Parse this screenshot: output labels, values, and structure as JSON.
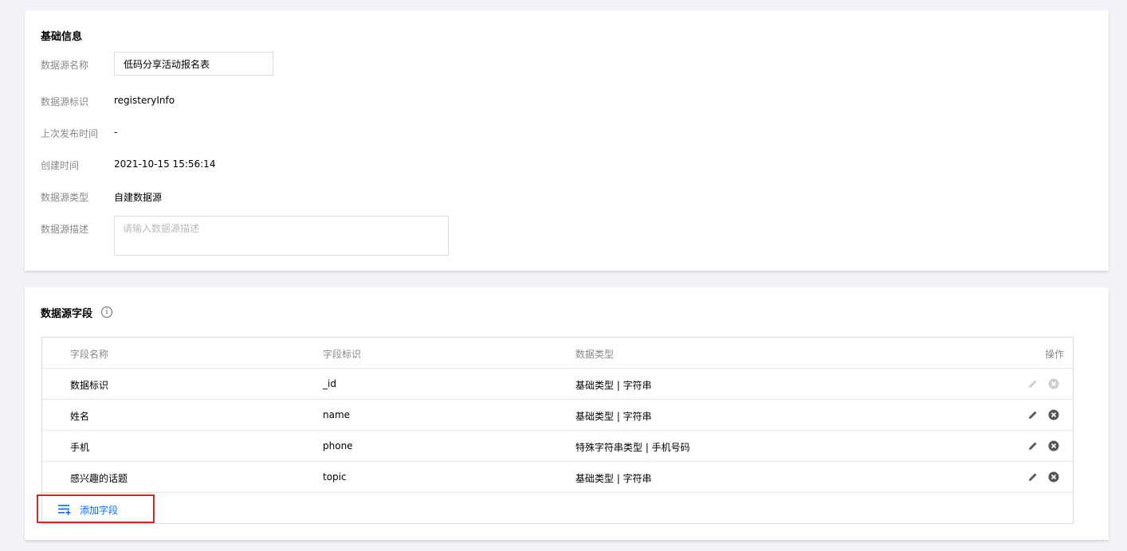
{
  "basic": {
    "title": "基础信息",
    "name_label": "数据源名称",
    "name_value": "低码分享活动报名表",
    "id_label": "数据源标识",
    "id_value": "registeryInfo",
    "publish_label": "上次发布时间",
    "publish_value": "-",
    "created_label": "创建时间",
    "created_value": "2021-10-15 15:56:14",
    "type_label": "数据源类型",
    "type_value": "自建数据源",
    "desc_label": "数据源描述",
    "desc_placeholder": "请输入数据源描述"
  },
  "fields": {
    "title": "数据源字段",
    "columns": {
      "name": "字段名称",
      "id": "字段标识",
      "type": "数据类型",
      "ops": "操作"
    },
    "rows": [
      {
        "name": "数据标识",
        "id": "_id",
        "type": "基础类型 | 字符串",
        "disabled": true
      },
      {
        "name": "姓名",
        "id": "name",
        "type": "基础类型 | 字符串",
        "disabled": false
      },
      {
        "name": "手机",
        "id": "phone",
        "type": "特殊字符串类型 | 手机号码",
        "disabled": false
      },
      {
        "name": "感兴趣的话题",
        "id": "topic",
        "type": "基础类型 | 字符串",
        "disabled": false
      }
    ],
    "add_label": "添加字段"
  },
  "colors": {
    "accent": "#006eff",
    "highlight_border": "#e02020",
    "icon_active": "#555555",
    "icon_disabled": "#cccccc"
  },
  "icons": {
    "info": "info-icon",
    "edit": "pencil-icon",
    "delete": "close-circle-icon",
    "add": "add-list-icon"
  }
}
